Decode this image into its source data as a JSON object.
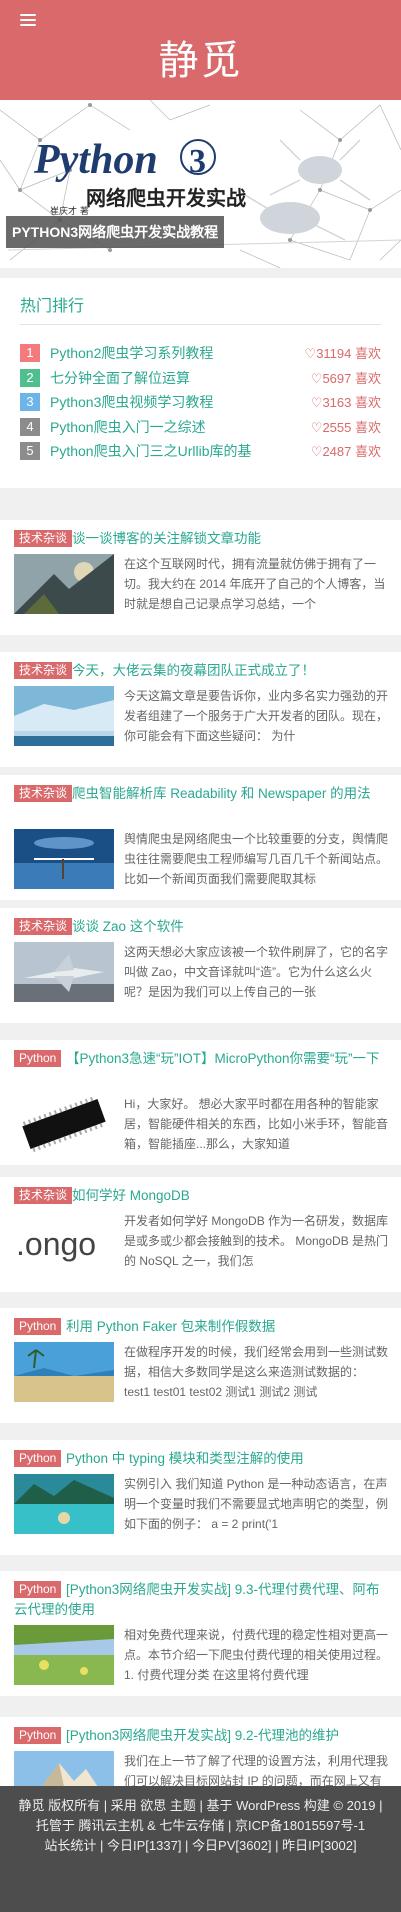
{
  "header": {
    "title": "静觅",
    "menu_icon": "hamburger-menu-icon"
  },
  "banner": {
    "image_text": {
      "main": "Python",
      "num": "3",
      "subtitle": "网络爬虫开发实战",
      "author": "崔庆才 著"
    },
    "caption": "PYTHON3网络爬虫开发实战教程"
  },
  "hot": {
    "title": "热门排行",
    "items": [
      {
        "rank": "1",
        "color": "#f37b7d",
        "title": "Python2爬虫学习系列教程",
        "likes": "31194 喜欢"
      },
      {
        "rank": "2",
        "color": "#4fc08d",
        "title": "七分钟全面了解位运算",
        "likes": "5697 喜欢"
      },
      {
        "rank": "3",
        "color": "#6db5e8",
        "title": "Python3爬虫视频学习教程",
        "likes": "3163 喜欢"
      },
      {
        "rank": "4",
        "color": "#8c8c8c",
        "title": "Python爬虫入门一之综述",
        "likes": "2555 喜欢"
      },
      {
        "rank": "5",
        "color": "#8c8c8c",
        "title": "Python爬虫入门三之Urllib库的基",
        "likes": "2487 喜欢"
      }
    ]
  },
  "posts": [
    {
      "tag": "技术杂谈",
      "title": "谈一谈博客的关注解锁文章功能",
      "excerpt": "在这个互联网时代，拥有流量就仿佛于拥有了一切。我大约在 2014 年底开了自己的个人博客，当时就是想自己记录点学习总结，一个"
    },
    {
      "tag": "技术杂谈",
      "title": "今天，大佬云集的夜幕团队正式成立了！",
      "excerpt": "今天这篇文章是要告诉你，业内多名实力强劲的开发者组建了一个服务于广大开发者的团队。现在，你可能会有下面这些疑问： 为什"
    },
    {
      "tag": "技术杂谈",
      "title": "爬虫智能解析库 Readability 和 Newspaper 的用法",
      "excerpt": "舆情爬虫是网络爬虫一个比较重要的分支，舆情爬虫往往需要爬虫工程师编写几百几千个新闻站点。比如一个新闻页面我们需要爬取其标"
    },
    {
      "tag": "技术杂谈",
      "title": "谈谈 Zao 这个软件",
      "excerpt": "这两天想必大家应该被一个软件刷屏了，它的名字叫做 Zao，中文音译就叫“造”。它为什么这么火呢？是因为我们可以上传自己的一张"
    },
    {
      "tag": "Python",
      "title": "【Python3急速“玩”IOT】MicroPython你需要“玩”一下",
      "excerpt": "Hi，大家好。 想必大家平时都在用各种的智能家居，智能硬件相关的东西，比如小米手环，智能音箱，智能插座...那么，大家知道"
    },
    {
      "tag": "技术杂谈",
      "title": "如何学好 MongoDB",
      "excerpt": "开发者如何学好 MongoDB 作为一名研发，数据库是或多或少都会接触到的技术。 MongoDB 是热门的 NoSQL 之一，我们怎"
    },
    {
      "tag": "Python",
      "title": "利用 Python Faker 包来制作假数据",
      "excerpt": "在做程序开发的时候，我们经常会用到一些测试数据，相信大多数同学是这么来造测试数据的： test1 test01 test02 测试1 测试2 测试"
    },
    {
      "tag": "Python",
      "title": "Python 中 typing 模块和类型注解的使用",
      "excerpt": "实例引入 我们知道 Python 是一种动态语言，在声明一个变量时我们不需要显式地声明它的类型，例如下面的例子： a = 2 print('1"
    },
    {
      "tag": "Python",
      "title": "[Python3网络爬虫开发实战] 9.3-代理付费代理、阿布云代理的使用",
      "excerpt": "相对免费代理来说，付费代理的稳定性相对更高一点。本节介绍一下爬虫付费代理的相关使用过程。 1. 付费代理分类 在这里将付费代理"
    },
    {
      "tag": "Python",
      "title": "[Python3网络爬虫开发实战] 9.2-代理池的维护",
      "excerpt": "我们在上一节了解了代理的设置方法，利用代理我们可以解决目标网站封 IP 的问题，而在网上又有大量公开的免费代理，其中有一部分"
    }
  ],
  "footer": {
    "line1": "静觅 版权所有 | 采用 欲思 主题 | 基于 WordPress 构建 © 2019 | 托管于 腾讯云主机 & 七牛云存储 | 京ICP备18015597号-1",
    "line2": "站长统计 | 今日IP[1337] | 今日PV[3602] | 昨日IP[3002]"
  },
  "colors": {
    "brand": "#d9696b",
    "link": "#2aa890",
    "footer_bg": "#4d4d4d"
  }
}
